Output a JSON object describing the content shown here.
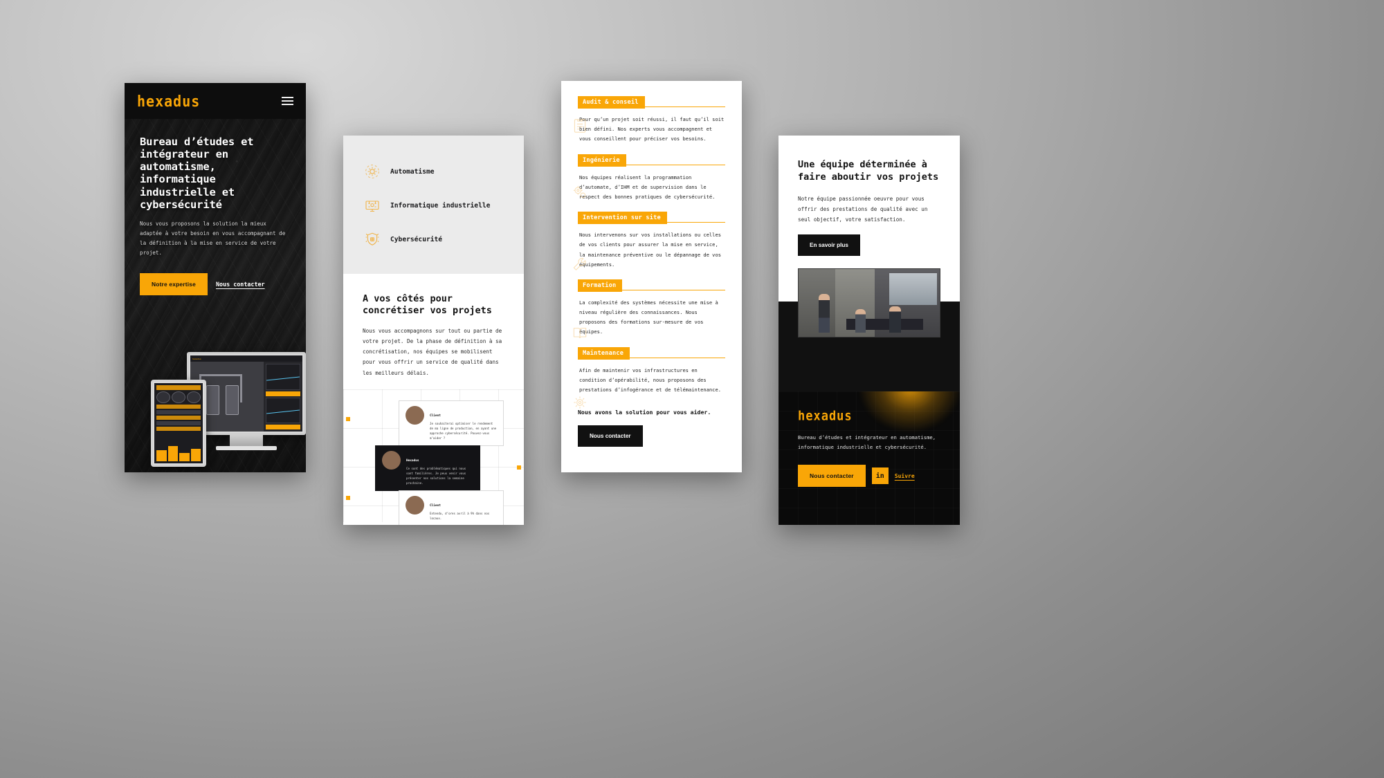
{
  "brand": {
    "name": "hexadus",
    "accent": "#f9a607",
    "dark": "#0d0d0d"
  },
  "hero": {
    "logo": "hexadus",
    "menu_icon": "hamburger-menu-icon",
    "title": "Bureau d’études et intégrateur en automatisme, informatique industrielle et cybersécurité",
    "subtitle": "Nous vous proposons la solution la mieux adaptée à votre besoin en vous accompagnant de la définition à la mise en service de votre projet.",
    "primary_cta": "Notre expertise",
    "secondary_cta": "Nous contacter"
  },
  "services": {
    "items": [
      {
        "label": "Automatisme",
        "icon": "gear-automation-icon"
      },
      {
        "label": "Informatique industrielle",
        "icon": "industrial-computer-icon"
      },
      {
        "label": "Cybersécurité",
        "icon": "shield-security-icon"
      }
    ]
  },
  "process": {
    "title": "A vos côtés pour concrétiser vos projets",
    "text": "Nous vous accompagnons sur tout ou partie de votre projet. De la phase de définition à sa concrétisation, nos équipes se mobilisent pour vous offrir un service de qualité dans les meilleurs délais.",
    "conversation": [
      {
        "author": "Client",
        "message": "Je souhaiterai optimiser le rendement de ma ligne de production, en ayant une approche cybersécurité. Pouvez-vous m’aider ?",
        "theme": "light"
      },
      {
        "author": "Hexadus",
        "message": "Ce sont des problématiques qui nous sont familières. Je peux venir vous présenter nos solutions la semaine prochaine.",
        "theme": "dark"
      },
      {
        "author": "Client",
        "message": "Entendu, d’ores avril à 9h dans nos locaux.",
        "theme": "light"
      }
    ]
  },
  "expertise": {
    "items": [
      {
        "tag": "Audit & conseil",
        "icon": "clipboard-audit-icon",
        "text": "Pour qu’un projet soit réussi, il faut qu’il soit bien défini. Nos experts vous accompagnent et vous conseillent pour préciser vos besoins."
      },
      {
        "tag": "Ingénierie",
        "icon": "gears-engineering-icon",
        "text": "Nos équipes réalisent la programmation d’automate, d’IHM et de supervision dans le respect des bonnes pratiques de cybersécurité."
      },
      {
        "tag": "Intervention sur site",
        "icon": "wrench-onsite-icon",
        "text": "Nous intervenons sur vos installations ou celles de vos clients pour assurer la mise en service, la maintenance préventive ou le dépannage de vos équipements."
      },
      {
        "tag": "Formation",
        "icon": "book-training-icon",
        "text": "La complexité des systèmes nécessite une mise à niveau régulière des connaissances. Nous proposons des formations sur-mesure de vos équipes."
      },
      {
        "tag": "Maintenance",
        "icon": "cog-maintenance-icon",
        "text": "Afin de maintenir vos infrastructures en condition d’opérabilité, nous proposons des prestations d’infogérance et de télémaintenance."
      }
    ],
    "closing": "Nous avons la solution pour vous aider.",
    "cta": "Nous contacter"
  },
  "team": {
    "title": "Une équipe déterminée à faire aboutir vos projets",
    "text": "Notre équipe passionnée oeuvre pour vous offrir des prestations de qualité  avec un seul objectif, votre satisfaction.",
    "cta": "En savoir plus",
    "photo_alt": "team-meeting-photo"
  },
  "footer": {
    "logo": "hexadus",
    "text": "Bureau d’études et intégrateur en automatisme, informatique industrielle et cybersécurité.",
    "cta": "Nous contacter",
    "social_icon": "in",
    "social_label": "Suivre"
  }
}
